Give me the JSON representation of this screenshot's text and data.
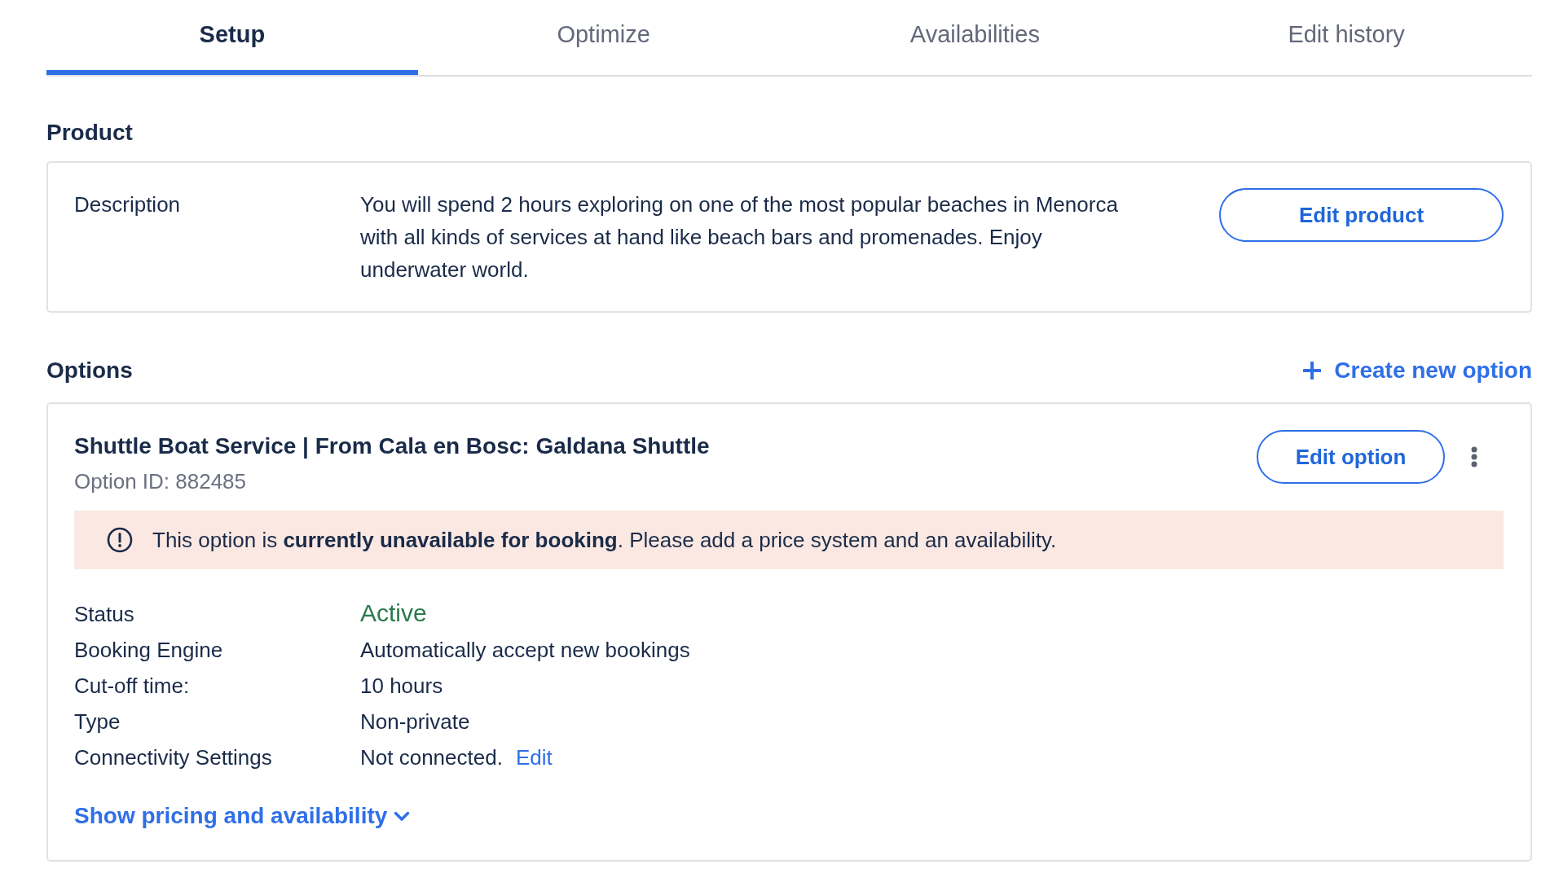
{
  "tabs": [
    {
      "label": "Setup",
      "selected": true
    },
    {
      "label": "Optimize",
      "selected": false
    },
    {
      "label": "Availabilities",
      "selected": false
    },
    {
      "label": "Edit history",
      "selected": false
    }
  ],
  "product": {
    "heading": "Product",
    "description_label": "Description",
    "description": "You will spend 2 hours exploring on one of the most popular beaches in Menorca with all kinds of services at hand like beach bars and promenades. Enjoy underwater world.",
    "edit_button": "Edit product"
  },
  "options": {
    "heading": "Options",
    "create_link": "Create new option",
    "items": [
      {
        "title": "Shuttle Boat Service | From Cala en Bosc: Galdana Shuttle",
        "option_id": "Option ID: 882485",
        "edit_button": "Edit option",
        "alert": "This option is **currently unavailable for booking**. Please add a price system and an availability.",
        "details": [
          {
            "kind": "status",
            "label": "Status",
            "value": "Active"
          },
          {
            "kind": "text",
            "label": "Booking Engine",
            "value": "Automatically accept new bookings"
          },
          {
            "kind": "text",
            "label": "Cut-off time:",
            "value": "10 hours"
          },
          {
            "kind": "text",
            "label": "Type",
            "value": "Non-private"
          },
          {
            "kind": "text",
            "label": "Connectivity Settings",
            "value": "Not connected.",
            "link": "Edit"
          }
        ],
        "toggle_link": "Show pricing and availability",
        "expanded": false
      }
    ]
  }
}
